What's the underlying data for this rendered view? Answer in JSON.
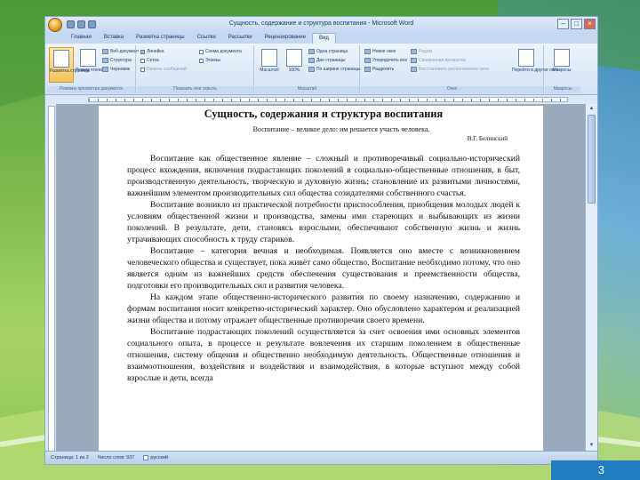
{
  "window": {
    "title": "Сущность, содержание и структура воспитания - Microsoft Word",
    "controls": [
      "–",
      "□",
      "×"
    ]
  },
  "tabs": [
    "Главная",
    "Вставка",
    "Разметка страницы",
    "Ссылки",
    "Рассылки",
    "Рецензирование",
    "Вид"
  ],
  "active_tab": "Вид",
  "ribbon": {
    "group_views": {
      "label": "Режимы просмотра документа",
      "big_buttons": [
        "Разметка страницы",
        "Режим чтения"
      ],
      "options": [
        "Веб-документ",
        "Структура",
        "Черновик"
      ]
    },
    "group_show": {
      "label": "Показать или скрыть",
      "options": [
        "Линейка",
        "Сетка",
        "Панель сообщений",
        "Схема документа",
        "Эскизы"
      ]
    },
    "group_zoom": {
      "label": "Масштаб",
      "big_buttons": [
        "Масштаб",
        "100%"
      ],
      "options": [
        "Одна страница",
        "Две страницы",
        "По ширине страницы"
      ]
    },
    "group_window": {
      "label": "Окно",
      "options": [
        "Новое окно",
        "Упорядочить все",
        "Разделить",
        "Рядом",
        "Синхронная прокрутка",
        "Восстановить расположение окна"
      ],
      "big_buttons": [
        "Перейти в другое окно"
      ]
    },
    "group_macros": {
      "label": "Макросы",
      "big_buttons": [
        "Макросы"
      ]
    }
  },
  "document": {
    "title": "Сущность, содержания и структура воспитания",
    "epigraph": "Воспитание – великое дело: им решается участь человека.",
    "epigraph_author": "В.Г. Белинский",
    "paragraphs": [
      "Воспитание как общественное явление – сложный и противоречивый социально-исторический процесс вхождения, включения подрастающих поколений в социально-общественные отношения, в быт, производственную деятельность, творческую и духовную жизнь; становление их развитыми личностями, важнейшим элементом производительных сил общества созидателями собственного счастья.",
      "Воспитание возникло из практической потребности приспособления, приобщения молодых людей к условиям общественной жизни и производства, замены ими стареющих и выбывающих из жизни поколений. В результате, дети, становясь взрослыми, обеспечивают собственную жизнь и жизнь утрачивающих способность к труду стариков.",
      "Воспитание – категория вечная и необходимая. Появляется оно вместе с возникновением человеческого общества и существует, пока живёт само общество. Воспитание необходимо потому, что оно является одним из важнейших средств обеспечения существования и преемственности общества, подготовки его производительных сил и развития человека.",
      "На каждом этапе общественно-исторического развития по своему назначению, содержанию и формам воспитания носит конкретно-исторический характер. Оно обусловлено характером и реализацией жизни общества и потому отражает общественные противоречия своего времени.",
      "Воспитание подрастающих поколений осуществляется за счет освоения ими основных элементов социального опыта, в процессе и результате вовлечения их старшим поколением в общественные отношения, систему общения и общественно необходимую деятельность. Общественные отношения и взаимоотношения, воздействия и воздействия и взаимодействия, в которые вступают между собой взрослые и дети, всегда"
    ]
  },
  "statusbar": {
    "page": "Страница: 1 из 2",
    "words": "Число слов: 937",
    "language": "русский"
  },
  "slide_number": "3"
}
